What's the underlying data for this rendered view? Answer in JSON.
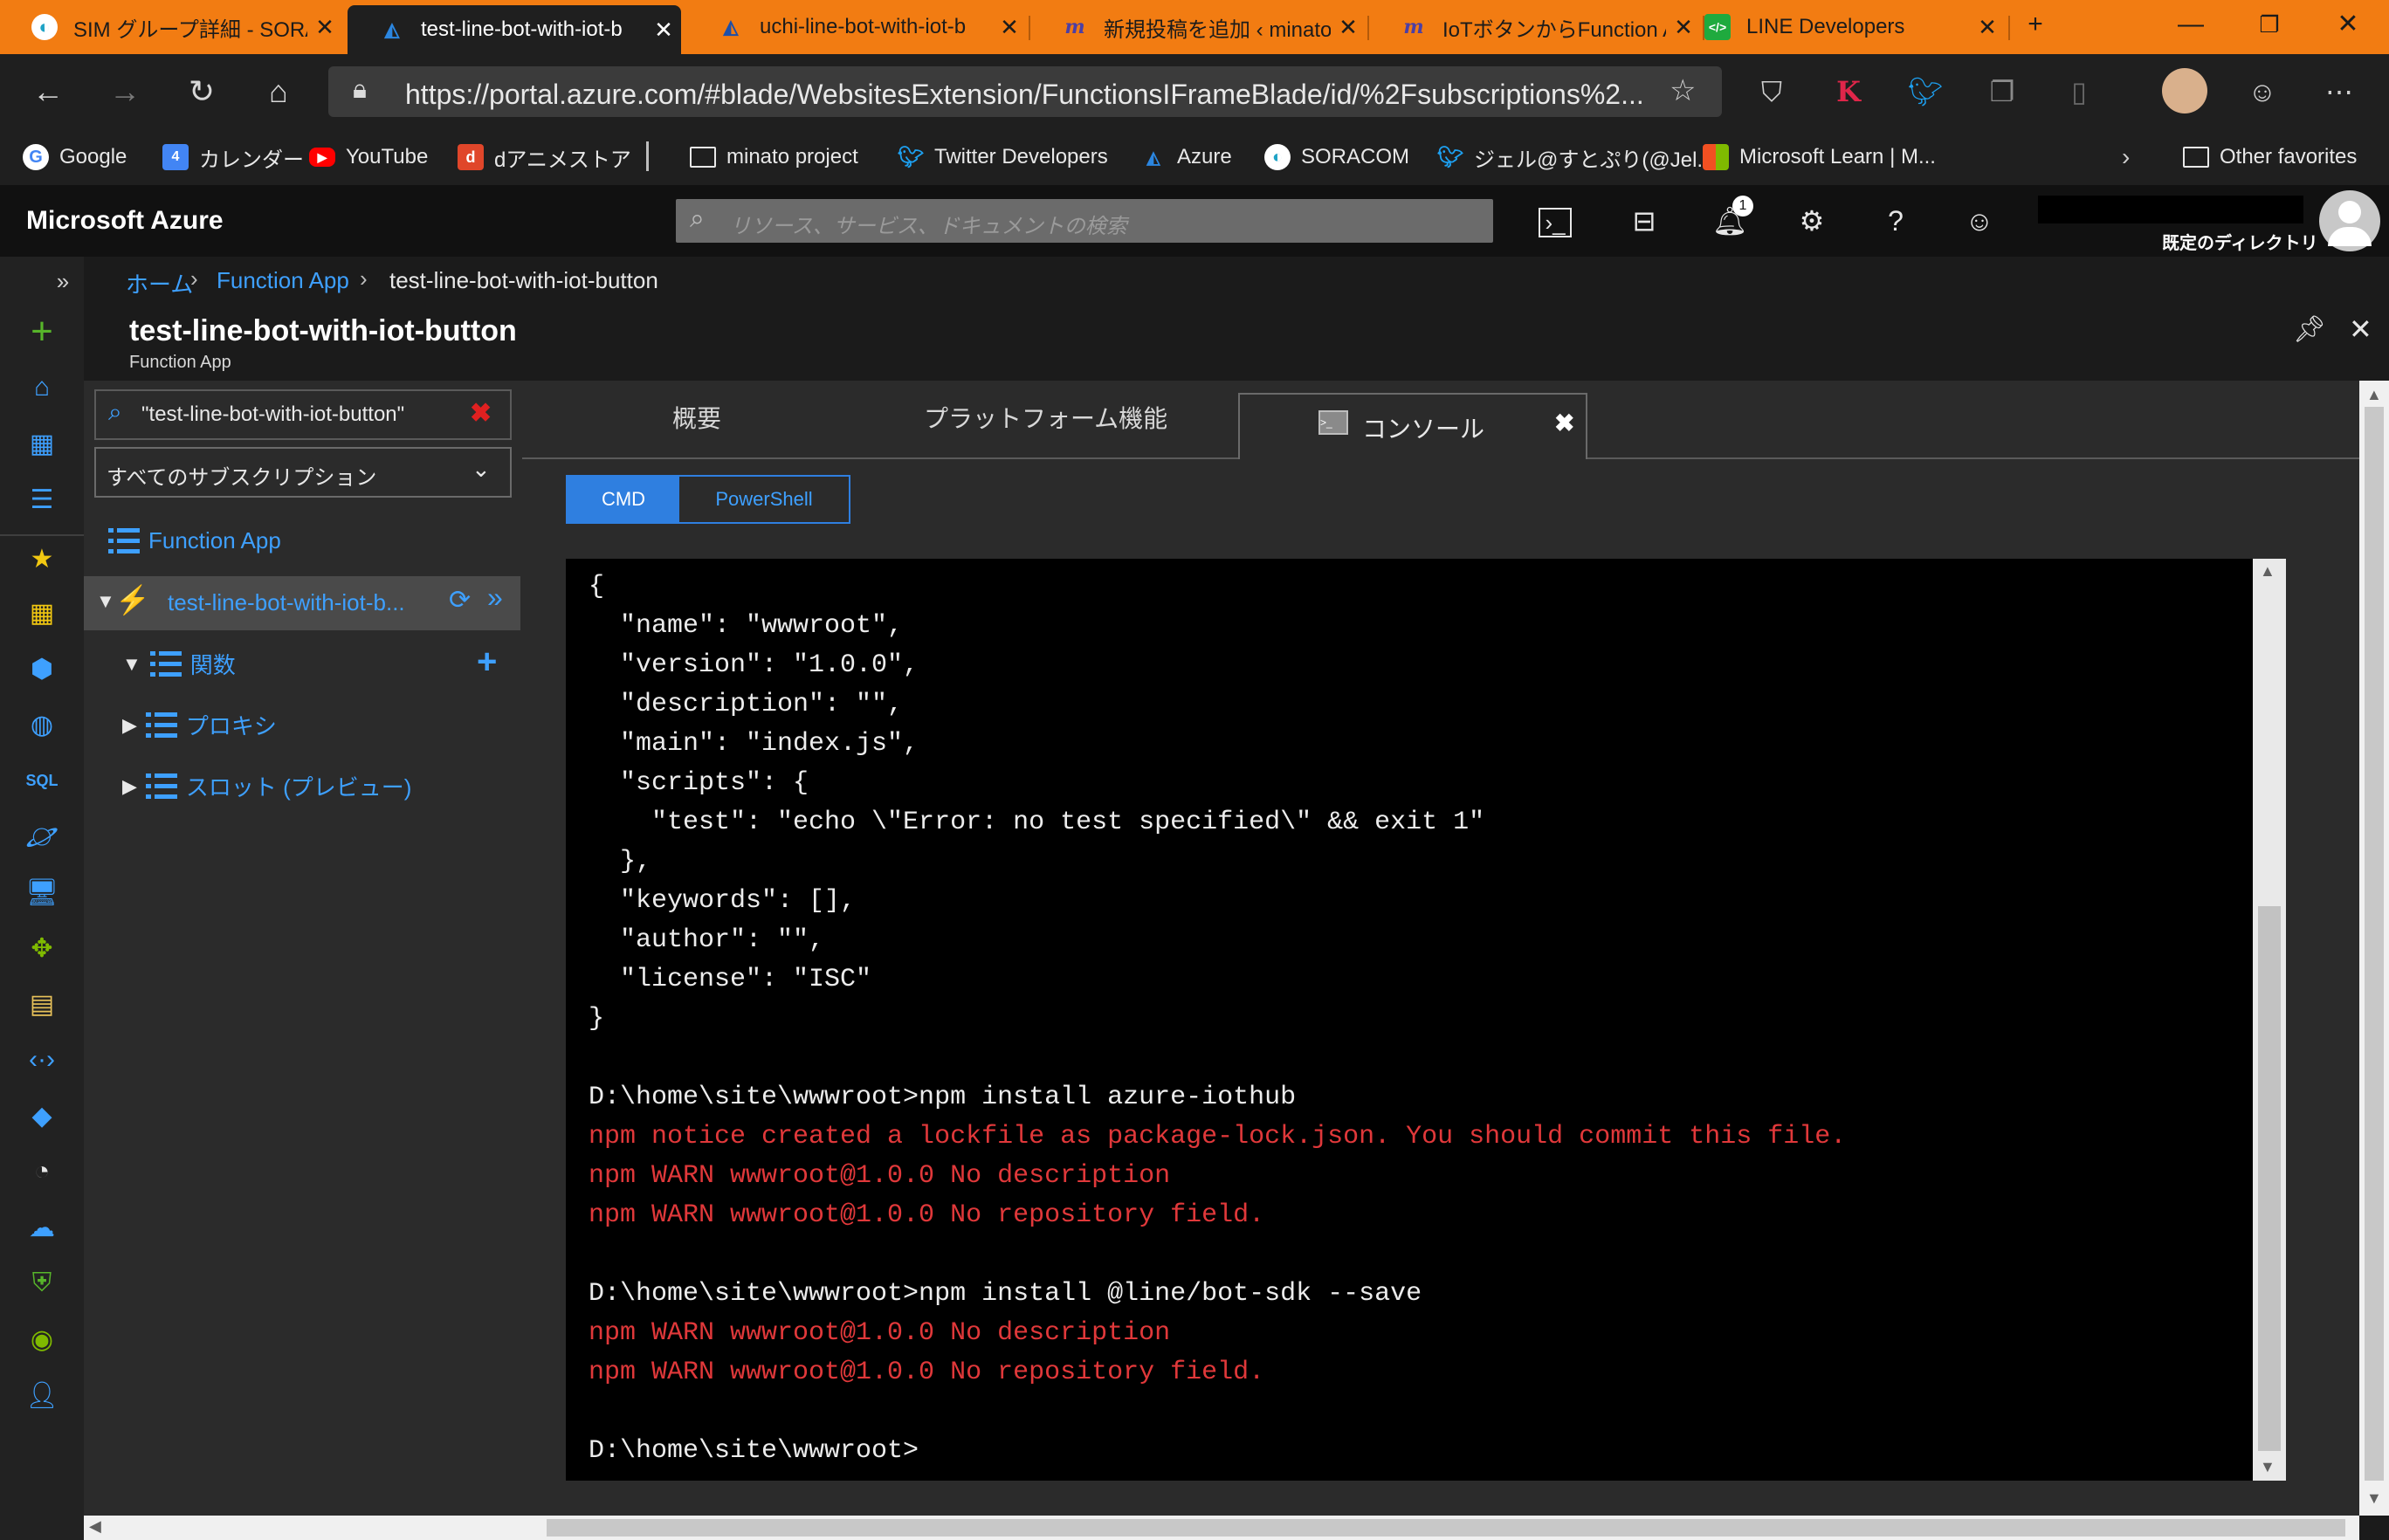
{
  "browser": {
    "tabs": [
      {
        "icon": "soracom-icon",
        "label": "SIM グループ詳細 - SORA",
        "active": false
      },
      {
        "icon": "azure-icon",
        "label": "test-line-bot-with-iot-b",
        "active": true
      },
      {
        "icon": "azure-icon",
        "label": "uchi-line-bot-with-iot-b",
        "active": false
      },
      {
        "icon": "wordpress-m-icon",
        "label": "新規投稿を追加 ‹ minato",
        "active": false
      },
      {
        "icon": "wordpress-m-icon",
        "label": "IoTボタンからFunction Ap",
        "active": false
      },
      {
        "icon": "line-developers-icon",
        "label": "LINE Developers",
        "active": false
      }
    ],
    "new_tab": "+",
    "url": "https://portal.azure.com/#blade/WebsitesExtension/FunctionsIFrameBlade/id/%2Fsubscriptions%2...",
    "favorites": [
      {
        "icon": "google-icon",
        "label": "Google"
      },
      {
        "icon": "calendar-icon",
        "label": "カレンダー"
      },
      {
        "icon": "youtube-icon",
        "label": "YouTube"
      },
      {
        "icon": "d-anime-icon",
        "label": "dアニメストア"
      },
      {
        "icon": "folder-icon",
        "label": "minato project"
      },
      {
        "icon": "twitter-icon",
        "label": "Twitter Developers"
      },
      {
        "icon": "azure-icon",
        "label": "Azure"
      },
      {
        "icon": "soracom-icon",
        "label": "SORACOM"
      },
      {
        "icon": "twitter-icon",
        "label": "ジェル@すとぷり(@Jel..."
      },
      {
        "icon": "microsoft-icon",
        "label": "Microsoft Learn | M..."
      }
    ],
    "other_favorites": "Other favorites",
    "colors": {
      "tabstrip": "#f27c12",
      "toolbar": "#1f1f1f"
    }
  },
  "azure": {
    "brand": "Microsoft Azure",
    "search_placeholder": "リソース、サービス、ドキュメントの検索",
    "notification_count": "1",
    "directory_label": "既定のディレクトリ",
    "breadcrumb": [
      "ホーム",
      "Function App",
      "test-line-bot-with-iot-button"
    ],
    "title": "test-line-bot-with-iot-button",
    "subtitle": "Function App"
  },
  "tree": {
    "filter_value": "\"test-line-bot-with-iot-button\"",
    "subscription": "すべてのサブスクリプション",
    "root_label": "Function App",
    "app_label": "test-line-bot-with-iot-b...",
    "items": [
      {
        "label": "関数",
        "expanded": true
      },
      {
        "label": "プロキシ",
        "expanded": false
      },
      {
        "label": "スロット (プレビュー)",
        "expanded": false
      }
    ]
  },
  "main": {
    "tabs": [
      "概要",
      "プラットフォーム機能",
      "コンソール"
    ],
    "shell_options": [
      "CMD",
      "PowerShell"
    ],
    "selected_shell": "CMD",
    "terminal_lines": [
      {
        "text": "{",
        "color": "white"
      },
      {
        "text": "  \"name\": \"wwwroot\",",
        "color": "white"
      },
      {
        "text": "  \"version\": \"1.0.0\",",
        "color": "white"
      },
      {
        "text": "  \"description\": \"\",",
        "color": "white"
      },
      {
        "text": "  \"main\": \"index.js\",",
        "color": "white"
      },
      {
        "text": "  \"scripts\": {",
        "color": "white"
      },
      {
        "text": "    \"test\": \"echo \\\"Error: no test specified\\\" && exit 1\"",
        "color": "white"
      },
      {
        "text": "  },",
        "color": "white"
      },
      {
        "text": "  \"keywords\": [],",
        "color": "white"
      },
      {
        "text": "  \"author\": \"\",",
        "color": "white"
      },
      {
        "text": "  \"license\": \"ISC\"",
        "color": "white"
      },
      {
        "text": "}",
        "color": "white"
      },
      {
        "text": "",
        "color": "white"
      },
      {
        "text": "D:\\home\\site\\wwwroot>npm install azure-iothub",
        "color": "white"
      },
      {
        "text": "npm notice created a lockfile as package-lock.json. You should commit this file.",
        "color": "red"
      },
      {
        "text": "npm WARN wwwroot@1.0.0 No description",
        "color": "red"
      },
      {
        "text": "npm WARN wwwroot@1.0.0 No repository field.",
        "color": "red"
      },
      {
        "text": "",
        "color": "white"
      },
      {
        "text": "D:\\home\\site\\wwwroot>npm install @line/bot-sdk --save",
        "color": "white"
      },
      {
        "text": "npm WARN wwwroot@1.0.0 No description",
        "color": "red"
      },
      {
        "text": "npm WARN wwwroot@1.0.0 No repository field.",
        "color": "red"
      },
      {
        "text": "",
        "color": "white"
      },
      {
        "text": "D:\\home\\site\\wwwroot>",
        "color": "white"
      }
    ]
  }
}
